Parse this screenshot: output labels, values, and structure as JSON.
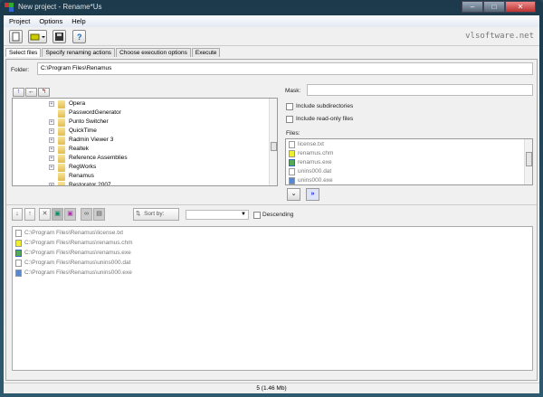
{
  "window": {
    "title": "New project - Rename*Us"
  },
  "menu": [
    "Project",
    "Options",
    "Help"
  ],
  "toolbar": {
    "brand": "vlsoftware.net"
  },
  "tabs": [
    "Select files",
    "Specify renaming actions",
    "Choose execution options",
    "Execute"
  ],
  "folder": {
    "label": "Folder:",
    "value": "C:\\Program Files\\Renamus"
  },
  "tree": [
    {
      "name": "Opera",
      "expandable": true
    },
    {
      "name": "PasswordGenerator",
      "expandable": false
    },
    {
      "name": "Punto Switcher",
      "expandable": true
    },
    {
      "name": "QuickTime",
      "expandable": true
    },
    {
      "name": "Radmin Viewer 3",
      "expandable": true
    },
    {
      "name": "Realtek",
      "expandable": true
    },
    {
      "name": "Reference Assemblies",
      "expandable": true
    },
    {
      "name": "RegWorks",
      "expandable": true
    },
    {
      "name": "Renamus",
      "expandable": false
    },
    {
      "name": "Restorator 2007",
      "expandable": true
    }
  ],
  "mask": {
    "label": "Mask:",
    "value": ""
  },
  "options": {
    "subdirs": "Include subdirectories",
    "readonly": "Include read-only files"
  },
  "files": {
    "label": "Files:",
    "items": [
      "license.txt",
      "renamus.chm",
      "renamus.exe",
      "unins000.dat",
      "unins000.exe"
    ]
  },
  "results": {
    "sort_label": "Sort by:",
    "sort_value": "",
    "descending": "Descending",
    "items": [
      "C:\\Program Files\\Renamus\\license.txt",
      "C:\\Program Files\\Renamus\\renamus.chm",
      "C:\\Program Files\\Renamus\\renamus.exe",
      "C:\\Program Files\\Renamus\\unins000.dat",
      "C:\\Program Files\\Renamus\\unins000.exe"
    ]
  },
  "status": "5  (1.46 Mb)"
}
